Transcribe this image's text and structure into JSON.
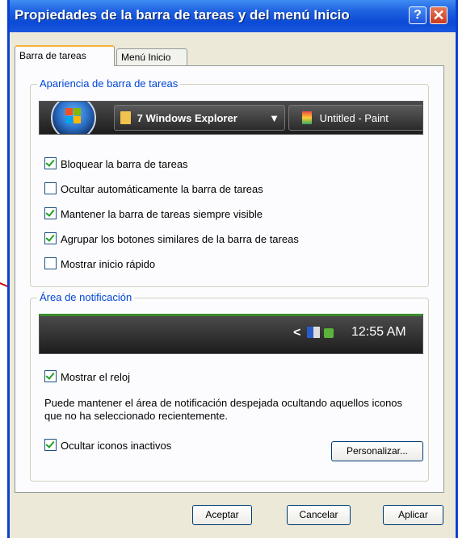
{
  "window": {
    "title": "Propiedades de la barra de tareas y del menú Inicio"
  },
  "titlebar": {
    "help_glyph": "?",
    "close_glyph": "✕"
  },
  "tabs": [
    {
      "label": "Barra de tareas",
      "active": true
    },
    {
      "label": "Menú Inicio",
      "active": false
    }
  ],
  "taskbar_group": {
    "title": "Apariencia de barra de tareas",
    "preview_items": [
      {
        "label": "7 Windows Explorer",
        "icon": "folder-icon"
      },
      {
        "label": "Untitled - Paint",
        "icon": "paint-icon"
      }
    ],
    "options": [
      {
        "label": "Bloquear la barra de tareas",
        "checked": true
      },
      {
        "label": "Ocultar automáticamente la barra de tareas",
        "checked": false
      },
      {
        "label": "Mantener la barra de tareas siempre visible",
        "checked": true
      },
      {
        "label": "Agrupar los botones similares de la barra de tareas",
        "checked": true
      },
      {
        "label": "Mostrar inicio rápido",
        "checked": false
      }
    ]
  },
  "notification_group": {
    "title": "Área de notificación",
    "preview_time": "12:55 AM",
    "show_clock": {
      "label": "Mostrar el reloj",
      "checked": true
    },
    "description": "Puede mantener el área de notificación despejada ocultando aquellos iconos que no ha seleccionado recientemente.",
    "hide_inactive": {
      "label": "Ocultar iconos inactivos",
      "checked": true
    },
    "customize_label": "Personalizar..."
  },
  "footer": {
    "ok_label": "Aceptar",
    "cancel_label": "Cancelar",
    "apply_label": "Aplicar"
  },
  "colors": {
    "title_bar": "#0a4ad6",
    "group_title": "#0046d5",
    "annotation_arrow": "#d00000"
  }
}
